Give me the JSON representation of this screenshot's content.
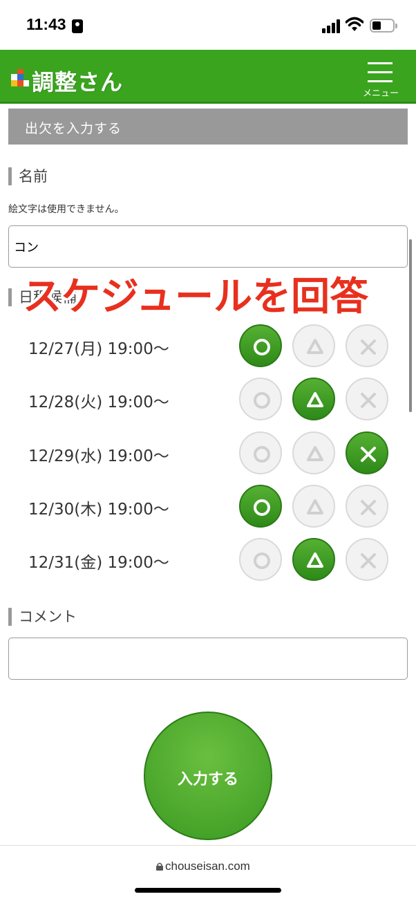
{
  "status_bar": {
    "time": "11:43"
  },
  "header": {
    "logo_text": "調整さん",
    "menu_label": "メニュー"
  },
  "section": {
    "title": "出欠を入力する"
  },
  "name_field": {
    "heading": "名前",
    "note": "絵文字は使用できません。",
    "value": "コン"
  },
  "schedule": {
    "heading": "日程候補",
    "rows": [
      {
        "date": "12/27(月) 19:00〜",
        "selected": "circle"
      },
      {
        "date": "12/28(火) 19:00〜",
        "selected": "triangle"
      },
      {
        "date": "12/29(水) 19:00〜",
        "selected": "cross"
      },
      {
        "date": "12/30(木) 19:00〜",
        "selected": "circle"
      },
      {
        "date": "12/31(金) 19:00〜",
        "selected": "triangle"
      }
    ]
  },
  "overlay": {
    "caption": "スケジュールを回答"
  },
  "comment_field": {
    "heading": "コメント",
    "value": ""
  },
  "submit": {
    "label": "入力する"
  },
  "browser": {
    "url": "chouseisan.com"
  },
  "colors": {
    "brand_green": "#3aa41f",
    "caption_red": "#e8301e",
    "section_gray": "#999999"
  },
  "icons": [
    "portrait-icon",
    "signal-icon",
    "wifi-icon",
    "battery-icon",
    "logo-icon",
    "menu-icon",
    "circle-icon",
    "triangle-icon",
    "cross-icon",
    "lock-icon"
  ]
}
